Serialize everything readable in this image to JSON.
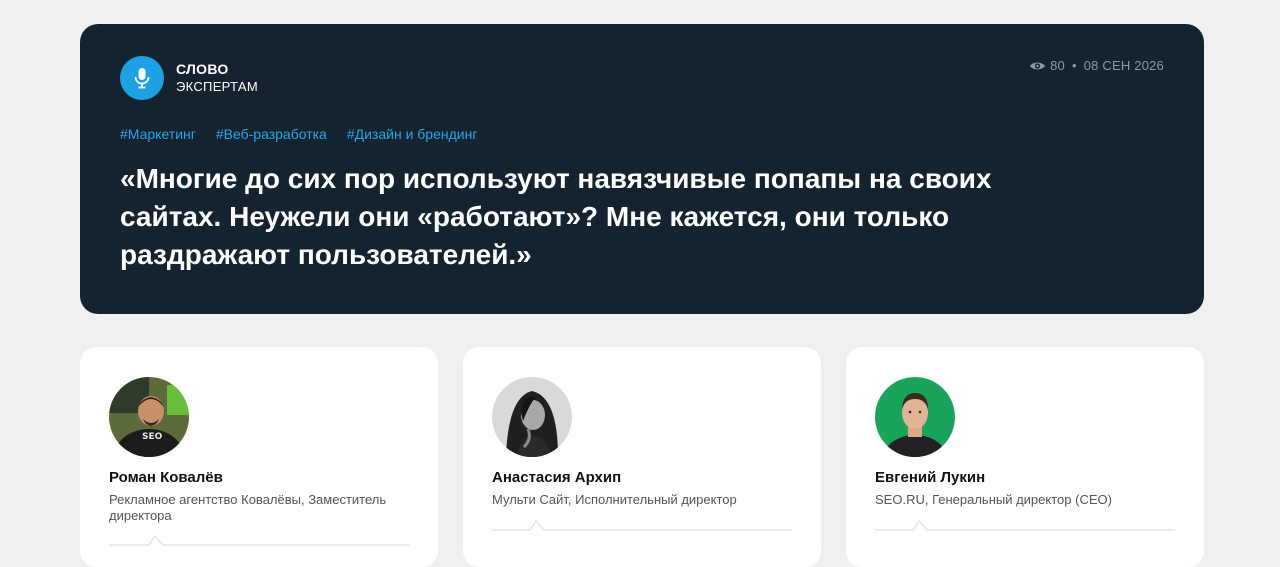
{
  "brand": {
    "line1": "СЛОВО",
    "line2": "ЭКСПЕРТАМ",
    "logo_icon": "microphone-icon",
    "logo_color": "#1ea1e3"
  },
  "meta": {
    "views": "80",
    "separator": "•",
    "date": "08 СЕН 2026",
    "view_icon": "eye-icon"
  },
  "tags": [
    "#Маркетинг",
    "#Веб-разработка",
    "#Дизайн и брендинг"
  ],
  "quote": "«Многие до сих пор используют навязчивые попапы на своих сайтах. Неужели они «работают»? Мне кажется, они только раздражают пользователей.»",
  "colors": {
    "hero_bg": "#14232f",
    "accent": "#27a8e8",
    "page_bg": "#f0f0f0"
  },
  "experts": [
    {
      "name": "Роман Ковалёв",
      "role": "Рекламное агентство Ковалёвы, Заместитель директора"
    },
    {
      "name": "Анастасия Архип",
      "role": "Мульти Сайт, Исполнительный директор"
    },
    {
      "name": "Евгений Лукин",
      "role": "SEO.RU, Генеральный директор (CEO)"
    }
  ]
}
